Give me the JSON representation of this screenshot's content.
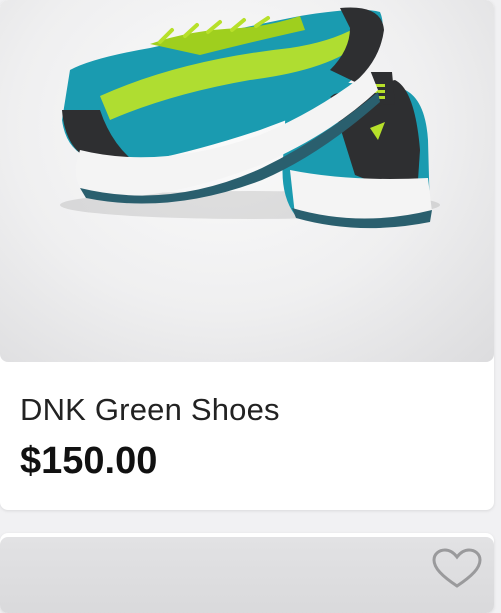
{
  "product": {
    "name": "DNK Green Shoes",
    "price": "$150.00",
    "image_icon": "shoe-image"
  },
  "next_product": {
    "favorite_icon": "heart-outline-icon"
  },
  "colors": {
    "shoe_teal": "#1a9bb0",
    "shoe_lime": "#b7e02a",
    "card_bg": "#ffffff",
    "page_bg": "#f1f1f3"
  }
}
